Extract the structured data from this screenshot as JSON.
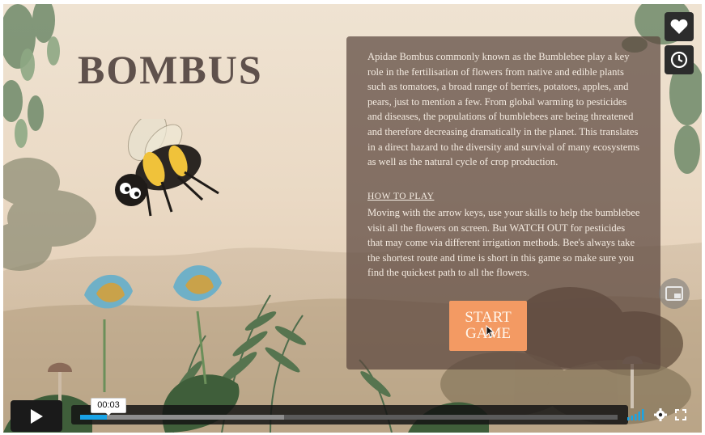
{
  "game": {
    "title": "BOMBUS",
    "intro_text": "Apidae Bombus commonly known as the Bumblebee play a key role in the fertilisation of flowers from native and edible plants such as tomatoes, a broad range of berries, potatoes, apples, and pears, just to mention a few. From global warming to pesticides and diseases, the populations of bumblebees are being threatened and therefore decreasing dramatically in the planet. This translates in a direct hazard to the diversity and survival of many ecosystems as well as the natural cycle of crop production.",
    "howto_heading": "HOW TO PLAY",
    "howto_text": "Moving with the arrow keys, use your skills to help the bumblebee visit all the flowers on screen. But WATCH OUT for pesticides that may come via different irrigation methods. Bee's always take the shortest route and time is short in this game so make sure you find the quickest path to all the flowers.",
    "start_button": "START GAME"
  },
  "player": {
    "current_time": "00:03",
    "progress_fraction": 0.05,
    "buffered_fraction": 0.38,
    "accent_color": "#19a4e6",
    "icons": {
      "like": "heart-icon",
      "watch_later": "clock-icon",
      "pip": "picture-in-picture-icon",
      "play": "play-icon",
      "volume": "volume-bars-icon",
      "settings": "gear-icon",
      "fullscreen": "fullscreen-icon"
    }
  }
}
